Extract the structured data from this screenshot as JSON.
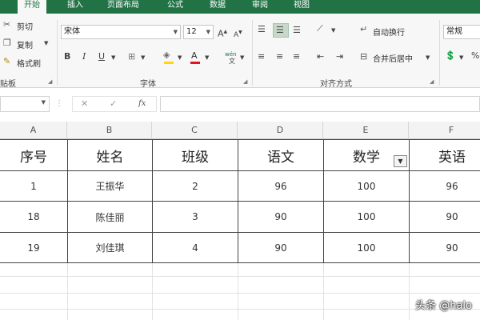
{
  "tabs": [
    "开始",
    "插入",
    "页面布局",
    "公式",
    "数据",
    "审阅",
    "视图"
  ],
  "clipboard": {
    "cut": "剪切",
    "copy": "复制",
    "format_painter": "格式刷",
    "group_label": "贴板"
  },
  "font": {
    "name": "宋体",
    "size": "12",
    "grow": "A",
    "shrink": "A",
    "bold": "B",
    "italic": "I",
    "underline": "U",
    "font_color_glyph": "A",
    "phonetic": "wén",
    "group_label": "字体"
  },
  "alignment": {
    "wrap_text": "自动换行",
    "merge_center": "合并后居中",
    "group_label": "对齐方式"
  },
  "number": {
    "format": "常规",
    "percent": "%"
  },
  "formula_bar": {
    "fx": "fx",
    "cancel": "✕",
    "enter": "✓"
  },
  "columns": [
    "A",
    "B",
    "C",
    "D",
    "E",
    "F"
  ],
  "table": {
    "headers": [
      "序号",
      "姓名",
      "班级",
      "语文",
      "数学",
      "英语"
    ],
    "rows": [
      [
        "1",
        "王振华",
        "2",
        "96",
        "100",
        "96"
      ],
      [
        "18",
        "陈佳丽",
        "3",
        "90",
        "100",
        "90"
      ],
      [
        "19",
        "刘佳琪",
        "4",
        "90",
        "100",
        "90"
      ]
    ]
  },
  "filter_glyph": "▼",
  "watermark": "头条 @halo",
  "colors": {
    "accent": "#217346",
    "ribbon_bg": "#f7f7f7",
    "font_color": "#e81123",
    "fill_color": "#ffd800"
  }
}
